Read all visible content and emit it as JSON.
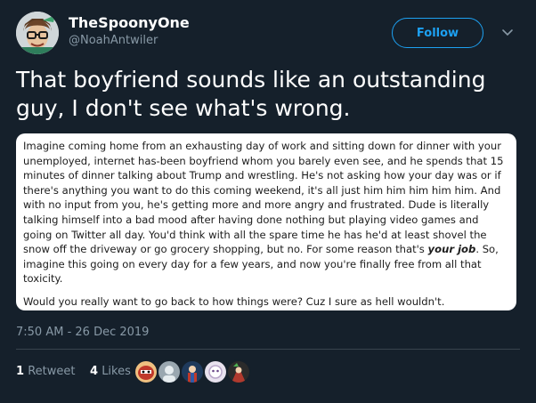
{
  "author": {
    "display_name": "TheSpoonyOne",
    "handle": "@NoahAntwiler",
    "avatar_icon": "avatar-illustration-icon"
  },
  "follow_button": {
    "label": "Follow",
    "color": "#1da1f2"
  },
  "caret_icon": "chevron-down-icon",
  "tweet": {
    "text": "That boyfriend sounds like an outstanding guy, I don't see what's wrong."
  },
  "quoted_image": {
    "paragraph1_before": "Imagine coming home from an exhausting day of work and sitting down for dinner with your unemployed, internet has-been boyfriend whom you barely even see, and he spends that 15 minutes of dinner talking about Trump and wrestling. He's not asking how your day was or if there's anything you want to do this coming weekend, it's all just him him him him him. And with no input from you, he's getting more and more angry and frustrated. Dude is literally talking himself into a bad mood after having done nothing but playing video games and going on Twitter all day. You'd think with all the spare time he has he'd at least shovel the snow off the driveway or go grocery shopping, but no. For some reason that's ",
    "paragraph1_emphasis": "your job",
    "paragraph1_after": ". So, imagine this going on every day for a few years, and now you're finally free from all that toxicity.",
    "paragraph2": "Would you really want to go back to how things were? Cuz I sure as hell wouldn't."
  },
  "timestamp": "7:50 AM - 26 Dec 2019",
  "stats": {
    "retweets_count": "1",
    "retweets_label": "Retweet",
    "likes_count": "4",
    "likes_label": "Likes"
  },
  "likers": [
    {
      "icon": "liker-avatar-1-icon"
    },
    {
      "icon": "liker-avatar-2-icon"
    },
    {
      "icon": "liker-avatar-3-icon"
    },
    {
      "icon": "liker-avatar-4-icon"
    },
    {
      "icon": "liker-avatar-5-icon"
    }
  ],
  "colors": {
    "background": "#15202b",
    "secondary_text": "#8899a6",
    "divider": "#38444d"
  }
}
